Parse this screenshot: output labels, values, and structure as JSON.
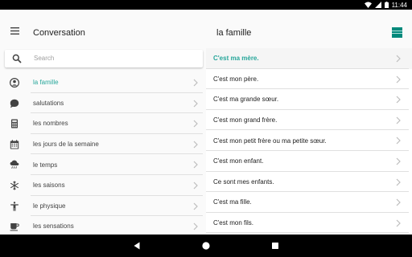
{
  "status_bar": {
    "time": "11:44",
    "icons": [
      "wifi-icon",
      "signal-icon",
      "battery-icon"
    ]
  },
  "app_bar": {
    "title": "Conversation",
    "detail_title": "la famille",
    "menu_icon": "menu-icon"
  },
  "search": {
    "placeholder": "Search",
    "icon": "search-icon"
  },
  "topics": [
    {
      "label": "la famille",
      "icon": "person-icon",
      "active": true
    },
    {
      "label": "salutations",
      "icon": "chat-bubble-icon",
      "active": false
    },
    {
      "label": "les nombres",
      "icon": "calculator-icon",
      "active": false
    },
    {
      "label": "les jours de la semaine",
      "icon": "calendar-icon",
      "active": false
    },
    {
      "label": "le temps",
      "icon": "weather-icon",
      "active": false
    },
    {
      "label": "les saisons",
      "icon": "snowflake-icon",
      "active": false
    },
    {
      "label": "le physique",
      "icon": "accessibility-icon",
      "active": false
    },
    {
      "label": "les sensations",
      "icon": "coffee-icon",
      "active": false
    }
  ],
  "phrases": [
    {
      "label": "C'est ma mère.",
      "active": true
    },
    {
      "label": "C'est mon père.",
      "active": false
    },
    {
      "label": "C'est ma grande sœur.",
      "active": false
    },
    {
      "label": "C'est mon grand frère.",
      "active": false
    },
    {
      "label": "C'est mon petit frère ou ma petite sœur.",
      "active": false
    },
    {
      "label": "C'est mon enfant.",
      "active": false
    },
    {
      "label": "Ce sont mes enfants.",
      "active": false
    },
    {
      "label": "C'est ma fille.",
      "active": false
    },
    {
      "label": "C'est mon fils.",
      "active": false
    }
  ],
  "colors": {
    "accent": "#26a69a",
    "logo": "#00897b",
    "divider": "#e0e0e0",
    "pane_bg": "#fafafa"
  },
  "nav_bar": {
    "buttons": [
      "back-icon",
      "home-icon",
      "recents-icon"
    ]
  }
}
